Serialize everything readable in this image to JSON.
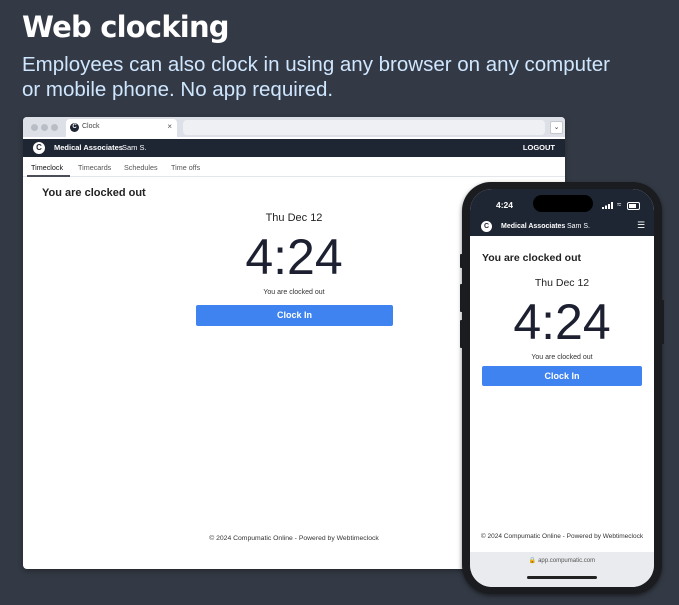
{
  "hero": {
    "title": "Web clocking",
    "subtitle": "Employees can also clock in using any browser on any computer or mobile phone. No app required."
  },
  "browser": {
    "tab_title": "Clock",
    "favicon_letter": "C",
    "dropdown_glyph": "⌄",
    "header": {
      "logo_letter": "C",
      "org": "Medical Associates",
      "user": "Sam S.",
      "logout": "LOGOUT"
    },
    "nav_tabs": [
      "Timeclock",
      "Timecards",
      "Schedules",
      "Time offs"
    ],
    "active_tab": "Timeclock",
    "status_heading": "You are clocked out",
    "date": "Thu Dec 12",
    "time": "4:24",
    "status_sub": "You are clocked out",
    "clock_in_label": "Clock In",
    "footer": "© 2024 Compumatic Online - Powered by Webtimeclock"
  },
  "phone": {
    "status_time": "4:24",
    "header": {
      "logo_letter": "C",
      "org": "Medical Associates",
      "user": "Sam S.",
      "menu_glyph": "☰"
    },
    "status_heading": "You are clocked out",
    "date": "Thu Dec 12",
    "time": "4:24",
    "status_sub": "You are clocked out",
    "clock_in_label": "Clock In",
    "footer": "© 2024 Compumatic Online - Powered by Webtimeclock",
    "url": "app.compumatic.com",
    "url_icon": "🔒"
  },
  "colors": {
    "background": "#343a45",
    "header": "#1e2533",
    "accent": "#3f83f0",
    "subtitle": "#cfe6ff"
  }
}
